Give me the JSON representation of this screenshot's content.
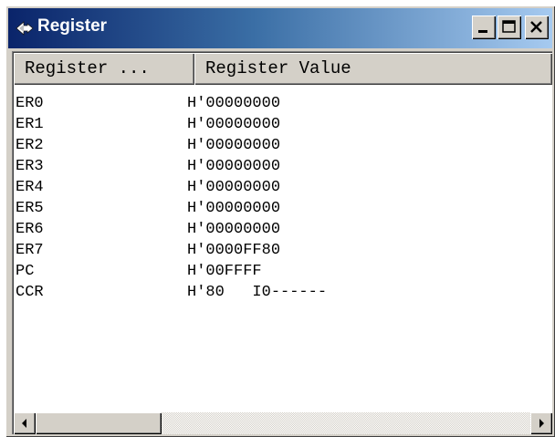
{
  "window": {
    "title": "Register",
    "icon": "register-app-icon",
    "buttons": [
      "minimize-icon",
      "maximize-icon",
      "close-icon"
    ]
  },
  "table": {
    "columns": [
      "Register ...",
      "Register Value"
    ],
    "rows": [
      {
        "name": "ER0",
        "value": "H'00000000"
      },
      {
        "name": "ER1",
        "value": "H'00000000"
      },
      {
        "name": "ER2",
        "value": "H'00000000"
      },
      {
        "name": "ER3",
        "value": "H'00000000"
      },
      {
        "name": "ER4",
        "value": "H'00000000"
      },
      {
        "name": "ER5",
        "value": "H'00000000"
      },
      {
        "name": "ER6",
        "value": "H'00000000"
      },
      {
        "name": "ER7",
        "value": "H'0000FF80"
      },
      {
        "name": "PC",
        "value": "H'00FFFF"
      },
      {
        "name": "CCR",
        "value": "H'80   I0------"
      }
    ]
  },
  "scrollbar": {
    "left_icon": "arrow-left-icon",
    "right_icon": "arrow-right-icon"
  }
}
